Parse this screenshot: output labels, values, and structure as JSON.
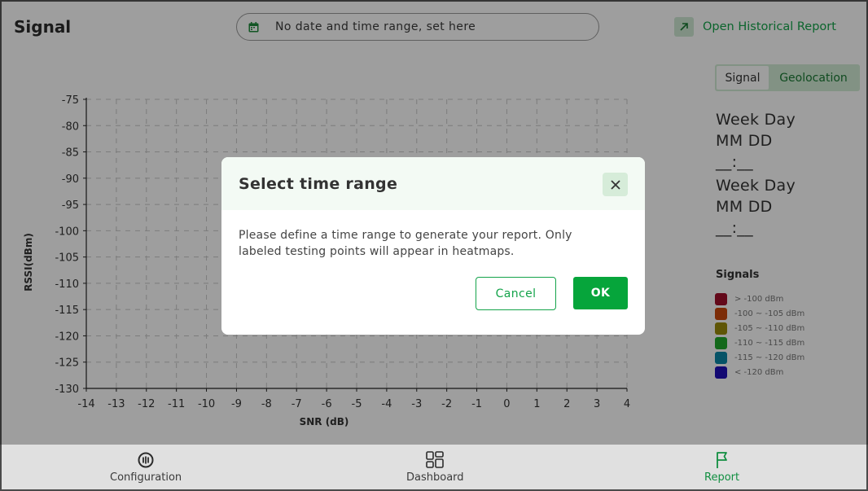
{
  "header": {
    "title": "Signal",
    "date_range_placeholder": "No date and time range, set here",
    "historical_report_label": "Open Historical Report"
  },
  "view_toggle": {
    "options": [
      "Signal",
      "Geolocation"
    ],
    "selected": "Signal"
  },
  "datetime": {
    "start_day": "Week Day",
    "start_date": "MM DD",
    "start_time": "__:__",
    "end_day": "Week Day",
    "end_date": "MM DD",
    "end_time": "__:__"
  },
  "legend": {
    "title": "Signals",
    "items": [
      {
        "label": "> -100 dBm",
        "color": "#a0102a"
      },
      {
        "label": "-100 ~ -105 dBm",
        "color": "#c8480c"
      },
      {
        "label": "-105 ~ -110 dBm",
        "color": "#9a8c0a"
      },
      {
        "label": "-110 ~ -115 dBm",
        "color": "#1fa82a"
      },
      {
        "label": "-115 ~ -120 dBm",
        "color": "#0a86a6"
      },
      {
        "label": "< -120 dBm",
        "color": "#2010b8"
      }
    ]
  },
  "chart_data": {
    "type": "scatter",
    "xlabel": "SNR (dB)",
    "ylabel": "RSSI(dBm)",
    "xlim": [
      -14,
      4
    ],
    "ylim": [
      -130,
      -75
    ],
    "x_ticks": [
      "-14",
      "-13",
      "-12",
      "-11",
      "-10",
      "-9",
      "-8",
      "-7",
      "-6",
      "-5",
      "-4",
      "-3",
      "-2",
      "-1",
      "0",
      "1",
      "2",
      "3",
      "4"
    ],
    "y_ticks": [
      "-75",
      "-80",
      "-85",
      "-90",
      "-95",
      "-100",
      "-105",
      "-110",
      "-115",
      "-120",
      "-125",
      "-130"
    ],
    "grid": true,
    "points": []
  },
  "dialog": {
    "title": "Select time range",
    "message": "Please define a time range to generate your report. Only labeled testing points will appear in heatmaps.",
    "cancel_label": "Cancel",
    "ok_label": "OK"
  },
  "nav": {
    "items": [
      {
        "label": "Configuration",
        "icon": "configuration-icon"
      },
      {
        "label": "Dashboard",
        "icon": "dashboard-icon"
      },
      {
        "label": "Report",
        "icon": "report-flag-icon"
      }
    ],
    "active": "Report"
  }
}
